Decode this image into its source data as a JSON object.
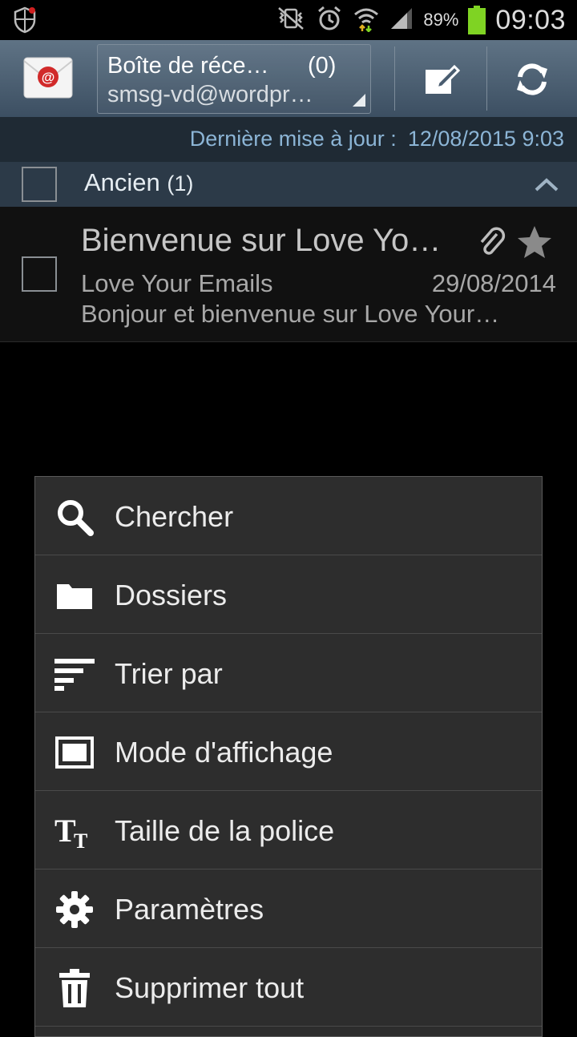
{
  "status_bar": {
    "battery_percent": "89%",
    "clock": "09:03",
    "icons": [
      "shield-icon",
      "vibrate-mute-icon",
      "alarm-icon",
      "wifi-icon",
      "signal-icon",
      "battery-icon"
    ]
  },
  "action_bar": {
    "app_icon": "email-app-icon",
    "mailbox_title": "Boîte de réce…",
    "mailbox_count": "(0)",
    "account": "smsg-vd@wordpr…",
    "compose_icon": "compose-icon",
    "refresh_icon": "refresh-icon"
  },
  "last_update": {
    "label": "Dernière mise à jour :",
    "value": "12/08/2015 9:03"
  },
  "group": {
    "label": "Ancien",
    "count": "(1)"
  },
  "messages": [
    {
      "subject": "Bienvenue sur Love Yo…",
      "sender": "Love Your Emails",
      "date": "29/08/2014",
      "preview": "Bonjour et bienvenue sur Love Your…",
      "has_attachment": true,
      "starred": false
    }
  ],
  "menu": {
    "items": [
      {
        "label": "Chercher",
        "icon": "search-icon"
      },
      {
        "label": "Dossiers",
        "icon": "folder-icon"
      },
      {
        "label": "Trier par",
        "icon": "sort-icon"
      },
      {
        "label": "Mode d'affichage",
        "icon": "view-mode-icon"
      },
      {
        "label": "Taille de la police",
        "icon": "font-size-icon"
      },
      {
        "label": "Paramètres",
        "icon": "settings-gear-icon"
      },
      {
        "label": "Supprimer tout",
        "icon": "trash-icon"
      }
    ]
  },
  "colors": {
    "action_bar": "#4a5d70",
    "accent_text": "#8cb5d6",
    "battery": "#7fd323",
    "menu_bg": "#2d2d2d"
  }
}
